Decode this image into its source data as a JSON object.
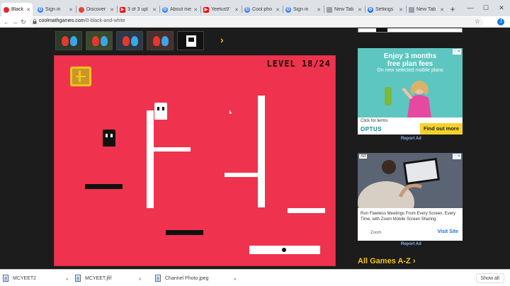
{
  "tabs": [
    {
      "label": "Black",
      "icon": "coolmath-icon",
      "color": "#e8232a",
      "active": true
    },
    {
      "label": "Sign in",
      "icon": "google-icon",
      "color": "#4285f4"
    },
    {
      "label": "Discover",
      "icon": "youtube-studio-icon",
      "color": "#ea4335"
    },
    {
      "label": "3 of 3 upl",
      "icon": "youtube-icon",
      "color": "#ff0000"
    },
    {
      "label": "About me",
      "icon": "google-icon",
      "color": "#4285f4"
    },
    {
      "label": "Yeetus9̃",
      "icon": "youtube-icon",
      "color": "#ff0000"
    },
    {
      "label": "Cool pho",
      "icon": "google-icon",
      "color": "#4285f4"
    },
    {
      "label": "Sign in",
      "icon": "google-icon",
      "color": "#4285f4"
    },
    {
      "label": "New Tab",
      "icon": "page-icon",
      "color": "#9aa0a6"
    },
    {
      "label": "Settings",
      "icon": "gear-icon",
      "color": "#1a73e8"
    },
    {
      "label": "New Tab",
      "icon": "page-icon",
      "color": "#9aa0a6"
    }
  ],
  "window_controls": {
    "minimize": "—",
    "maximize": "☐",
    "close": "✕"
  },
  "toolbar": {
    "back": "←",
    "forward": "→",
    "reload": "↻",
    "url_host": "coolmathgames.com",
    "url_path": "/0-black-and-white",
    "star": "☆",
    "profile": "J"
  },
  "game": {
    "level": "LEVEL 18/24",
    "menu_icon": "menu-door-icon"
  },
  "ads": {
    "optus": {
      "headline_line1": "Enjoy 3 months",
      "headline_line2": "free plan fees",
      "subline": "On new selected mobile plans",
      "click_for_terms": "Click for terms",
      "brand": "OPTUS",
      "cta": "Find out more",
      "choices": "ⓘ✕"
    },
    "zoom": {
      "ad_label": "Ad",
      "text": "Run Flawless Meetings From Every Screen, Every Time, with Zoom Mobile Screen Sharing",
      "brand": "Zoom",
      "cta": "Visit Site",
      "choices": "ⓘ✕"
    },
    "report_label": "Report Ad"
  },
  "all_games": "All Games A-Z ›",
  "downloads": [
    {
      "name": "MCYEET2"
    },
    {
      "name": "MCYEET.jfif"
    },
    {
      "name": "Channel Photo.jpeg"
    }
  ],
  "show_all": "Show all"
}
